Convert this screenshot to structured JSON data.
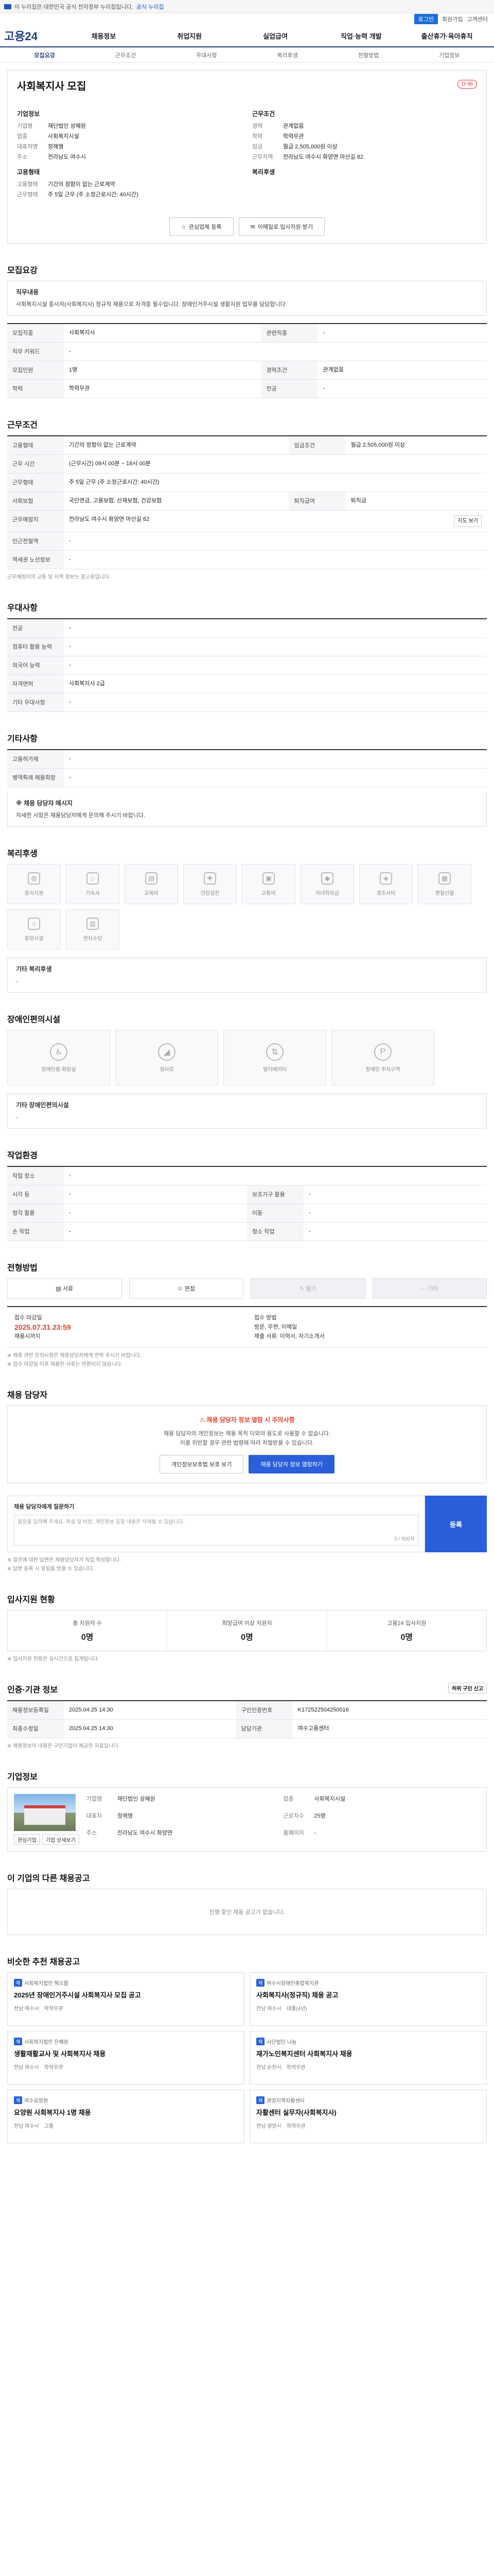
{
  "topbar": {
    "text": "이 누리집은 대한민국 공식 전자정부 누리집입니다.",
    "link": "공식 누리집"
  },
  "util": {
    "items": [
      "로그인",
      "회원가입",
      "고객센터"
    ],
    "login": "로그인"
  },
  "gnb": {
    "logo": "고용24",
    "items": [
      "채용정보",
      "취업지원",
      "실업급여",
      "직업·능력 개발",
      "출산휴가·육아휴직"
    ]
  },
  "subnav": [
    "모집요강",
    "근무조건",
    "우대사항",
    "복리후생",
    "전형방법",
    "기업정보"
  ],
  "hero": {
    "title": "사회복지사 모집",
    "dday": "D-98",
    "company_heading": "기업정보",
    "company": [
      {
        "k": "기업명",
        "v": "재단법인 성혜원"
      },
      {
        "k": "업종",
        "v": "사회복지시설"
      },
      {
        "k": "대표자명",
        "v": "정해명"
      },
      {
        "k": "주소",
        "v": "전라남도 여수시"
      }
    ],
    "cond_heading": "근무조건",
    "cond": [
      {
        "k": "경력",
        "v": "관계없음"
      },
      {
        "k": "학력",
        "v": "학력무관"
      },
      {
        "k": "임금",
        "v": "월급 2,505,000원 이상"
      },
      {
        "k": "근무지역",
        "v": "전라남도 여수시 화양면 마산길 82"
      }
    ],
    "hiring_heading": "고용형태",
    "hiring": [
      {
        "k": "고용형태",
        "v": "기간의 정함이 없는 근로계약"
      },
      {
        "k": "근무형태",
        "v": "주 5일 근무 (주 소정근로시간: 40시간)"
      }
    ],
    "benefit_heading": "복리후생",
    "btn_print": "관심업체 등록",
    "btn_scrap": "이메일로 입사지원 받기"
  },
  "recruit": {
    "heading": "모집요강",
    "job_heading": "직무내용",
    "job_text": "사회복지시설 종사자(사회복지사) 정규직 채용으로 자격증 필수입니다. 장애인거주시설 생활지원 업무를 담당합니다."
  },
  "recruit_table": [
    {
      "th": "모집직종",
      "td": "사회복지사"
    },
    {
      "th": "관련직종",
      "td": "-"
    },
    {
      "th": "직무 키워드",
      "td": "-"
    },
    {
      "th": "모집인원",
      "td": "1명"
    },
    {
      "th": "경력조건",
      "td": "관계없음"
    },
    {
      "th": "학력",
      "td": "학력무관"
    },
    {
      "th": "전공",
      "td": "-"
    }
  ],
  "work": {
    "heading": "근무조건",
    "rows": [
      {
        "th": "고용형태",
        "td": "기간의 정함이 없는 근로계약"
      },
      {
        "th": "임금조건",
        "td": "월급 2,505,000원 이상"
      },
      {
        "th": "근무 시간",
        "td": "(근무시간) 09시 00분 ~ 18시 00분"
      },
      {
        "th": "근무형태",
        "td": "주 5일 근무 (주 소정근로시간: 40시간)"
      },
      {
        "th": "사회보험",
        "td": "국민연금, 고용보험, 산재보험, 건강보험"
      },
      {
        "th": "퇴직급여",
        "td": "퇴직금"
      },
      {
        "th": "근무예정지",
        "td": "전라남도 여수시 화양면 마산길 82"
      },
      {
        "th": "인근전철역",
        "td": "-"
      },
      {
        "th": "역세권 노선정보",
        "td": "-"
      }
    ],
    "map_btn": "지도 보기",
    "note": "근무예정지의 교통 및 지역 정보는 참고용입니다."
  },
  "pref": {
    "heading": "우대사항",
    "rows": [
      {
        "th": "전공",
        "td": "-"
      },
      {
        "th": "컴퓨터 활용 능력",
        "td": "-"
      },
      {
        "th": "외국어 능력",
        "td": "-"
      },
      {
        "th": "자격면허",
        "td": "사회복지사 2급"
      },
      {
        "th": "기타 우대사항",
        "td": "-"
      }
    ]
  },
  "extra": {
    "heading": "기타사항",
    "rows": [
      {
        "th": "고용허가제",
        "td": "-"
      },
      {
        "th": "병역특례 채용희망",
        "td": "-"
      }
    ],
    "notice": "※ 채용 담당자 메시지",
    "notice_text": "자세한 사항은 채용담당자에게 문의해 주시기 바랍니다."
  },
  "welfare": {
    "heading": "복리후생",
    "items": [
      "중식지원",
      "기숙사",
      "교육비",
      "건강검진",
      "교통비",
      "자녀학자금",
      "경조사비",
      "명절선물",
      "휴양시설",
      "연차수당"
    ],
    "etc_heading": "기타 복리후생",
    "etc_text": "-"
  },
  "disabled": {
    "heading": "장애인편의시설",
    "items": [
      "장애인용 화장실",
      "경사로",
      "엘리베이터",
      "장애인 주차구역"
    ],
    "etc_heading": "기타 장애인편의시설",
    "etc_text": "-"
  },
  "workenv": {
    "heading": "작업환경",
    "rows": [
      {
        "th": "작업 장소",
        "td": "-",
        "th2": "",
        "td2": ""
      },
      {
        "th": "시각 등",
        "td": "-",
        "th2": "보조기구 활용",
        "td2": "-"
      },
      {
        "th": "청각 활용",
        "td": "-",
        "th2": "이동",
        "td2": "-"
      },
      {
        "th": "손 작업",
        "td": "-",
        "th2": "청소 작업",
        "td2": "-"
      }
    ]
  },
  "process": {
    "heading": "전형방법",
    "steps": [
      "서류",
      "면접",
      "필기",
      "기타"
    ],
    "apply": [
      {
        "label": "접수 마감일",
        "value": "2025.07.31 23:59",
        "sub": "채용시까지"
      },
      {
        "label": "접수 방법",
        "value": "방문, 우편, 이메일",
        "sub": "제출 서류: 이력서, 자기소개서"
      }
    ],
    "notes": [
      "※ 채용 관련 문의사항은 채용담당자에게 연락 주시기 바랍니다.",
      "※ 접수 마감일 이후 제출된 서류는 반환되지 않습니다."
    ]
  },
  "contact": {
    "heading": "채용 담당자",
    "warn": "채용 담당자 정보 열람 시 주의사항",
    "msg1": "채용 담당자의 개인정보는 채용 목적 이외의 용도로 사용할 수 없습니다.",
    "msg2": "이를 위반할 경우 관련 법령에 따라 처벌받을 수 있습니다.",
    "btn1": "개인정보보호법 보호 보기",
    "btn2": "채용 담당자 정보 열람하기"
  },
  "inquiry": {
    "heading": "채용 담당자에게 질문하기",
    "placeholder": "질문을 입력해 주세요. 욕설 및 비방, 개인정보 포함 내용은 삭제될 수 있습니다.",
    "count": "0 / 500자",
    "submit": "등록",
    "notes": [
      "※ 질문에 대한 답변은 채용담당자가 직접 작성합니다.",
      "※ 답변 등록 시 알림을 받을 수 있습니다."
    ]
  },
  "status": {
    "heading": "입사지원 현황",
    "items": [
      {
        "label": "총 지원자 수",
        "num": "0명"
      },
      {
        "label": "희망급여 이상 지원자",
        "num": "0명"
      },
      {
        "label": "고용24 입사지원",
        "num": "0명"
      }
    ],
    "note": "※ 입사지원 현황은 실시간으로 집계됩니다."
  },
  "info": {
    "heading": "인증·기관 정보",
    "rows": [
      {
        "th": "채용정보등록일",
        "td": "2025.04.25 14:30",
        "th2": "구인인증번호",
        "td2": "K172522504250016"
      },
      {
        "th": "최종수정일",
        "td": "2025.04.25 14:30",
        "th2": "담당기관",
        "td2": "여수고용센터"
      }
    ],
    "report_btn": "허위 구인 신고",
    "notes": [
      "※ 채용정보의 내용은 구인기업이 제공한 자료입니다."
    ]
  },
  "firm": {
    "heading": "기업정보",
    "fields": [
      {
        "k": "기업명",
        "v": "재단법인 성혜원"
      },
      {
        "k": "업종",
        "v": "사회복지시설"
      },
      {
        "k": "대표자",
        "v": "정해명"
      },
      {
        "k": "근로자수",
        "v": "25명"
      },
      {
        "k": "주소",
        "v": "전라남도 여수시 화양면"
      },
      {
        "k": "홈페이지",
        "v": "-"
      }
    ],
    "btn1": "관심기업",
    "btn2": "기업 상세보기"
  },
  "other": {
    "heading": "이 기업의 다른 채용공고",
    "empty": "진행 중인 채용 공고가 없습니다."
  },
  "recommend": {
    "heading": "비슷한 추천 채용공고",
    "cards": [
      {
        "corp": "사회복지법인 해오름",
        "title": "2025년 장애인거주시설 사회복지사 모집 공고",
        "loc": "전남 여수시",
        "edu": "학력무관"
      },
      {
        "corp": "여수시장애인종합복지관",
        "title": "사회복지사(정규직) 채용 공고",
        "loc": "전남 여수시",
        "edu": "대졸(4년)"
      },
      {
        "corp": "사회복지법인 은혜원",
        "title": "생활재활교사 및 사회복지사 채용",
        "loc": "전남 여수시",
        "edu": "학력무관"
      },
      {
        "corp": "사단법인 나눔",
        "title": "재가노인복지센터 사회복지사 채용",
        "loc": "전남 순천시",
        "edu": "학력무관"
      },
      {
        "corp": "여수요양원",
        "title": "요양원 사회복지사 1명 채용",
        "loc": "전남 여수시",
        "edu": "고졸"
      },
      {
        "corp": "광양지역자활센터",
        "title": "자활센터 실무자(사회복지사)",
        "loc": "전남 광양시",
        "edu": "학력무관"
      }
    ]
  }
}
